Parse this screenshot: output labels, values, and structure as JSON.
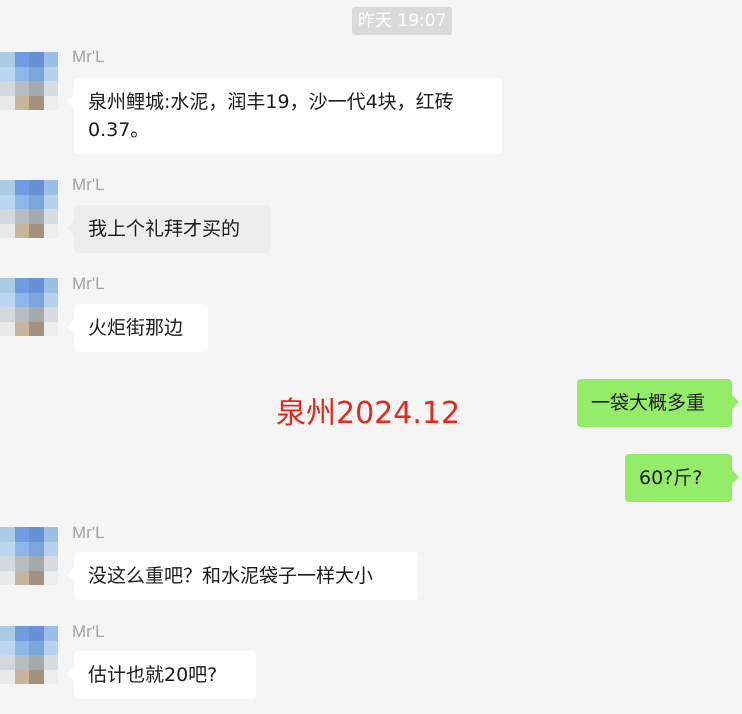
{
  "chat": {
    "timestamp": "昨天 19:07",
    "messages": [
      {
        "side": "left",
        "sender": "Mr'L",
        "text": "泉州鲤城:水泥，润丰19，沙一代4块，红砖\n0.37。"
      },
      {
        "side": "left",
        "sender": "Mr'L",
        "text": "我上个礼拜才买的"
      },
      {
        "side": "left",
        "sender": "Mr'L",
        "text": "火炬街那边"
      },
      {
        "side": "right",
        "text": "一袋大概多重"
      },
      {
        "side": "right",
        "text": "60?斤?"
      },
      {
        "side": "left",
        "sender": "Mr'L",
        "text": "没这么重吧？和水泥袋子一样大小"
      },
      {
        "side": "left",
        "sender": "Mr'L",
        "text": "估计也就20吧?"
      }
    ]
  },
  "watermark": "泉州2024.12",
  "colors": {
    "background": "#f5f5f5",
    "incoming_bubble": "#ffffff",
    "outgoing_bubble": "#95ec69",
    "watermark": "#e7261d",
    "sender_name": "#a3a3a3"
  }
}
